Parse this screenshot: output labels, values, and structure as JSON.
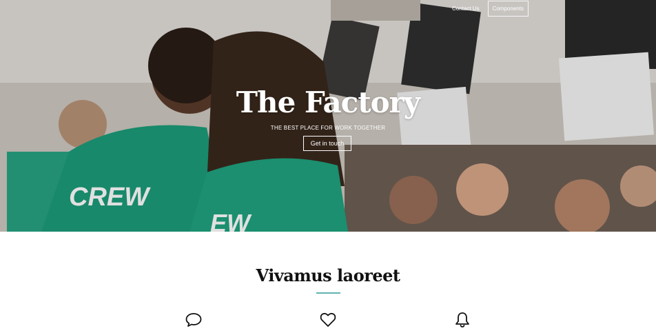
{
  "nav": {
    "contact_label": "Contact Us",
    "components_label": "Components"
  },
  "hero": {
    "title": "The Factory",
    "subtitle": "THE BEST PLACE FOR WORK TOGETHER",
    "cta_label": "Get in touch",
    "shirt_text_left": "CREW",
    "shirt_text_right": "EW"
  },
  "section": {
    "title": "Vivamus laoreet",
    "accent_color": "#5fb3ad"
  },
  "features": [
    {
      "icon": "chat-bubble-icon"
    },
    {
      "icon": "heart-icon"
    },
    {
      "icon": "bell-icon"
    }
  ]
}
